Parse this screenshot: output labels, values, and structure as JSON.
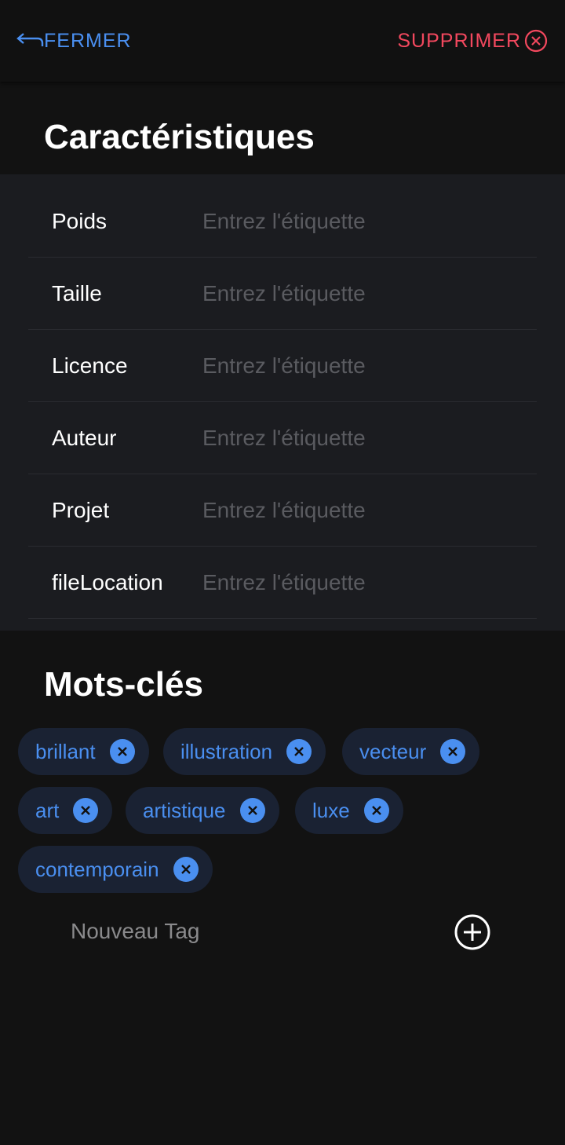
{
  "header": {
    "close_label": "FERMER",
    "delete_label": "SUPPRIMER",
    "close_color": "#4a8ff0",
    "delete_color": "#f2485e"
  },
  "characteristics": {
    "title": "Caractéristiques",
    "placeholder": "Entrez l'étiquette",
    "fields": [
      {
        "label": "Poids",
        "value": ""
      },
      {
        "label": "Taille",
        "value": ""
      },
      {
        "label": "Licence",
        "value": ""
      },
      {
        "label": "Auteur",
        "value": ""
      },
      {
        "label": "Projet",
        "value": ""
      },
      {
        "label": "fileLocation",
        "value": ""
      }
    ]
  },
  "keywords": {
    "title": "Mots-clés",
    "tags": [
      "brillant",
      "illustration",
      "vecteur",
      "art",
      "artistique",
      "luxe",
      "contemporain"
    ],
    "new_tag_placeholder": "Nouveau Tag",
    "accent": "#4a8ff0"
  }
}
